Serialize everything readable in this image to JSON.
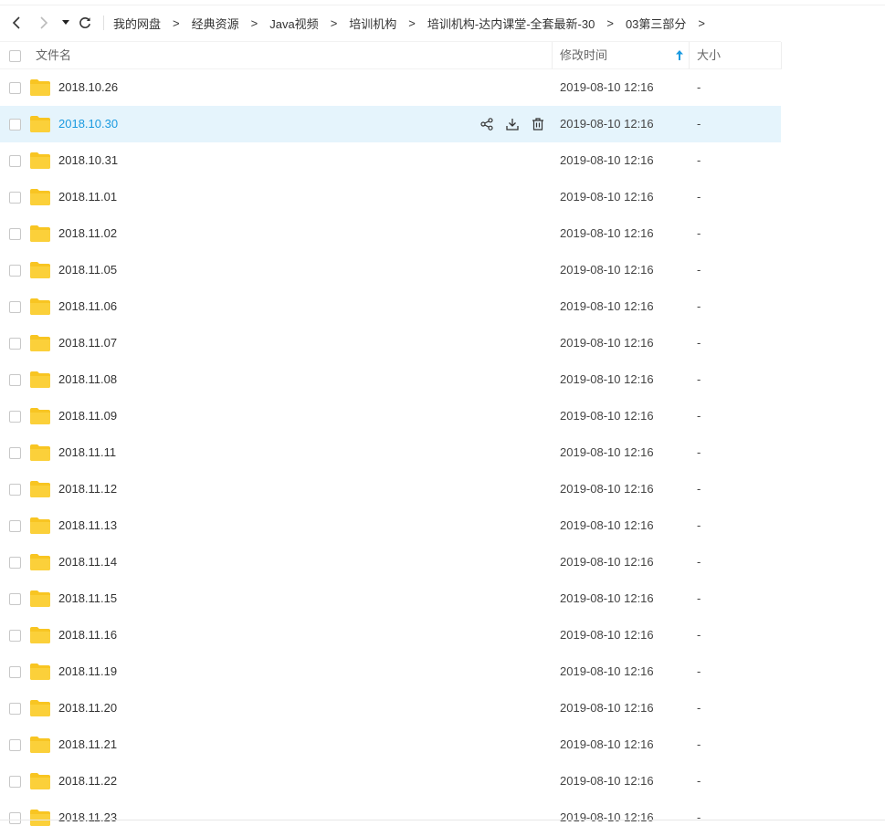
{
  "nav": {
    "back_icon": "chevron-left-icon",
    "forward_icon": "chevron-right-icon",
    "history_icon": "caret-down-icon",
    "refresh_icon": "refresh-icon"
  },
  "breadcrumb": {
    "separator": ">",
    "items": [
      "我的网盘",
      "经典资源",
      "Java视频",
      "培训机构",
      "培训机构-达内课堂-全套最新-30",
      "03第三部分"
    ]
  },
  "header": {
    "name": "文件名",
    "modified": "修改时间",
    "size": "大小",
    "sort_icon": "arrow-up-icon",
    "sort_color": "#1a9ae0"
  },
  "files": [
    {
      "name": "2018.10.26",
      "modified": "2019-08-10 12:16",
      "size": "-"
    },
    {
      "name": "2018.10.30",
      "modified": "2019-08-10 12:16",
      "size": "-",
      "hovered": true
    },
    {
      "name": "2018.10.31",
      "modified": "2019-08-10 12:16",
      "size": "-"
    },
    {
      "name": "2018.11.01",
      "modified": "2019-08-10 12:16",
      "size": "-"
    },
    {
      "name": "2018.11.02",
      "modified": "2019-08-10 12:16",
      "size": "-"
    },
    {
      "name": "2018.11.05",
      "modified": "2019-08-10 12:16",
      "size": "-"
    },
    {
      "name": "2018.11.06",
      "modified": "2019-08-10 12:16",
      "size": "-"
    },
    {
      "name": "2018.11.07",
      "modified": "2019-08-10 12:16",
      "size": "-"
    },
    {
      "name": "2018.11.08",
      "modified": "2019-08-10 12:16",
      "size": "-"
    },
    {
      "name": "2018.11.09",
      "modified": "2019-08-10 12:16",
      "size": "-"
    },
    {
      "name": "2018.11.11",
      "modified": "2019-08-10 12:16",
      "size": "-"
    },
    {
      "name": "2018.11.12",
      "modified": "2019-08-10 12:16",
      "size": "-"
    },
    {
      "name": "2018.11.13",
      "modified": "2019-08-10 12:16",
      "size": "-"
    },
    {
      "name": "2018.11.14",
      "modified": "2019-08-10 12:16",
      "size": "-"
    },
    {
      "name": "2018.11.15",
      "modified": "2019-08-10 12:16",
      "size": "-"
    },
    {
      "name": "2018.11.16",
      "modified": "2019-08-10 12:16",
      "size": "-"
    },
    {
      "name": "2018.11.19",
      "modified": "2019-08-10 12:16",
      "size": "-"
    },
    {
      "name": "2018.11.20",
      "modified": "2019-08-10 12:16",
      "size": "-"
    },
    {
      "name": "2018.11.21",
      "modified": "2019-08-10 12:16",
      "size": "-"
    },
    {
      "name": "2018.11.22",
      "modified": "2019-08-10 12:16",
      "size": "-"
    },
    {
      "name": "2018.11.23",
      "modified": "2019-08-10 12:16",
      "size": "-"
    }
  ],
  "row_actions": {
    "share_icon": "share-icon",
    "download_icon": "download-icon",
    "delete_icon": "trash-icon"
  },
  "colors": {
    "folder": "#f8c522",
    "hover_row_bg": "#e5f4fc",
    "hover_text": "#1a9ae0"
  }
}
